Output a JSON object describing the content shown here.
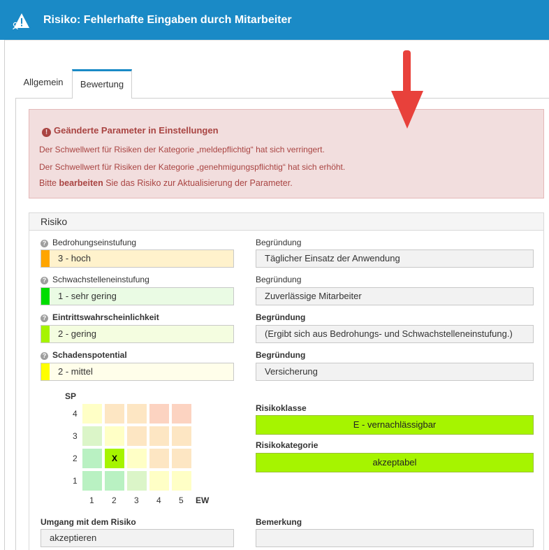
{
  "window": {
    "title": "Risiko: Fehlerhafte Eingaben durch Mitarbeiter",
    "icon": "warning-person-icon"
  },
  "tabs": [
    {
      "label": "Allgemein",
      "active": false
    },
    {
      "label": "Bewertung",
      "active": true
    }
  ],
  "alert": {
    "title": "Geänderte Parameter in Einstellungen",
    "line1": "Der Schwellwert für Risiken der Kategorie „meldepflichtig“ hat sich verringert.",
    "line2": "Der Schwellwert für Risiken der Kategorie „genehmigungspflichtig“ hat sich erhöht.",
    "line3_pre": "Bitte ",
    "line3_bold": "bearbeiten",
    "line3_post": " Sie das Risiko zur Aktualisierung der Parameter."
  },
  "risk": {
    "section_title": "Risiko",
    "threat": {
      "label": "Bedrohungseinstufung",
      "value": "3 - hoch",
      "color": "#ffa500",
      "bg": "#fff2cc"
    },
    "vulnerability": {
      "label": "Schwachstelleneinstufung",
      "value": "1 - sehr gering",
      "color": "#00dd00",
      "bg": "#eafbe4"
    },
    "probability": {
      "label": "Eintrittswahrscheinlichkeit",
      "value": "2 - gering",
      "color": "#a6f400",
      "bg": "#f4fde0"
    },
    "damage": {
      "label": "Schadenspotential",
      "value": "2 - mittel",
      "color": "#ffff00",
      "bg": "#fffeea"
    },
    "reason_label": "Begründung",
    "reason_threat": "Täglicher Einsatz der Anwendung",
    "reason_vulnerability": "Zuverlässige Mitarbeiter",
    "reason_probability": "(Ergibt sich aus Bedrohungs- und Schwachstelleneinstufung.)",
    "reason_damage": "Versicherung",
    "risk_class_label": "Risikoklasse",
    "risk_class_value": "E - vernachlässigbar",
    "risk_category_label": "Risikokategorie",
    "risk_category_value": "akzeptabel",
    "handling_label": "Umgang mit dem Risiko",
    "handling_value": "akzeptieren",
    "remark_label": "Bemerkung",
    "remark_value": ""
  },
  "matrix": {
    "y_axis": "SP",
    "x_axis": "EW",
    "x_ticks": [
      "1",
      "2",
      "3",
      "4",
      "5"
    ],
    "y_ticks": [
      "4",
      "3",
      "2",
      "1"
    ],
    "marker": "X",
    "marker_cell": {
      "ew": 2,
      "sp": 2
    },
    "colors": [
      [
        "#ffffc6",
        "#fde6c3",
        "#fde6c3",
        "#fcd3c1",
        "#fcd3c1"
      ],
      [
        "#dbf5c8",
        "#ffffc6",
        "#fde6c3",
        "#fde6c3",
        "#fde6c3"
      ],
      [
        "#b9f1c2",
        "#a6f400",
        "#ffffc6",
        "#fde6c3",
        "#fde6c3"
      ],
      [
        "#b9f1c2",
        "#b9f1c2",
        "#dbf5c8",
        "#ffffc6",
        "#ffffc6"
      ]
    ]
  }
}
